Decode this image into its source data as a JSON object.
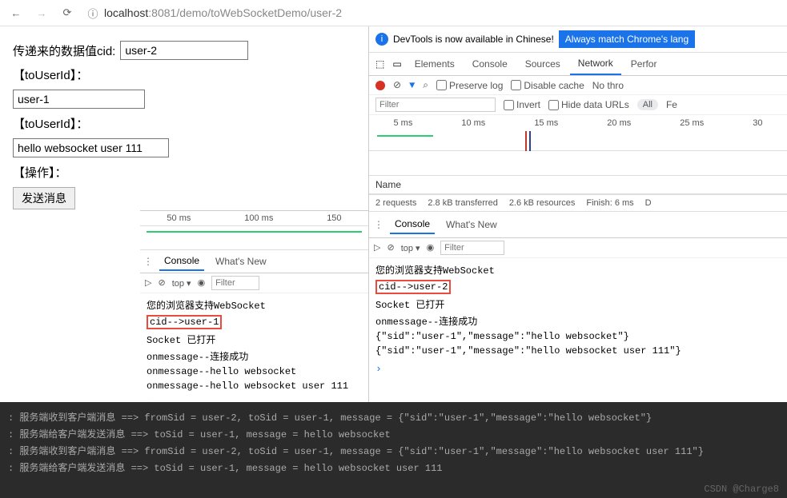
{
  "toolbar": {
    "url_host": "localhost",
    "url_port": ":8081",
    "url_path": "/demo/toWebSocketDemo/user-2"
  },
  "form": {
    "cid_label": "传递来的数据值cid:",
    "cid_value": "user-2",
    "to_user_label": "【toUserId】：",
    "to_user_value": "user-1",
    "msg_value": "hello websocket user 111",
    "action_label": "【操作】：",
    "send_btn": "发送消息"
  },
  "left_devtools": {
    "timeline": [
      "50 ms",
      "100 ms",
      "150"
    ],
    "tabs": {
      "console": "Console",
      "whatsnew": "What's New"
    },
    "console_ctrl": {
      "top": "top ▾",
      "filter_ph": "Filter"
    },
    "lines": [
      "您的浏览器支持WebSocket",
      "cid-->user-1",
      "Socket 已打开",
      "onmessage--连接成功",
      "onmessage--hello websocket",
      "onmessage--hello websocket user 111"
    ]
  },
  "banner": {
    "text": "DevTools is now available in Chinese!",
    "btn": "Always match Chrome's lang"
  },
  "right_devtools": {
    "tabs": {
      "elements": "Elements",
      "console": "Console",
      "sources": "Sources",
      "network": "Network",
      "performance": "Perfor"
    },
    "rec": {
      "preserve": "Preserve log",
      "disable": "Disable cache",
      "nothr": "No thro"
    },
    "filter": {
      "filter_ph": "Filter",
      "invert": "Invert",
      "hideurl": "Hide data URLs",
      "all": "All",
      "fe": "Fe"
    },
    "timeline": [
      "5 ms",
      "10 ms",
      "15 ms",
      "20 ms",
      "25 ms",
      "30"
    ],
    "name": "Name",
    "stats": [
      "2 requests",
      "2.8 kB transferred",
      "2.6 kB resources",
      "Finish: 6 ms",
      "D"
    ],
    "drawer_tabs": {
      "console": "Console",
      "whatsnew": "What's New"
    },
    "console_ctrl": {
      "top": "top ▾",
      "filter_ph": "Filter"
    },
    "lines": [
      "您的浏览器支持WebSocket",
      "cid-->user-2",
      "Socket 已打开",
      "onmessage--连接成功",
      "{\"sid\":\"user-1\",\"message\":\"hello websocket\"}",
      "{\"sid\":\"user-1\",\"message\":\"hello websocket user 111\"}"
    ]
  },
  "terminal": {
    "lines": [
      ": 服务端收到客户端消息 ==> fromSid = user-2, toSid = user-1, message = {\"sid\":\"user-1\",\"message\":\"hello websocket\"}",
      ": 服务端给客户端发送消息 ==> toSid = user-1, message = hello websocket",
      ": 服务端收到客户端消息 ==> fromSid = user-2, toSid = user-1, message = {\"sid\":\"user-1\",\"message\":\"hello websocket user 111\"}",
      ": 服务端给客户端发送消息 ==> toSid = user-1, message = hello websocket user 111"
    ],
    "watermark": "CSDN @Charge8"
  }
}
